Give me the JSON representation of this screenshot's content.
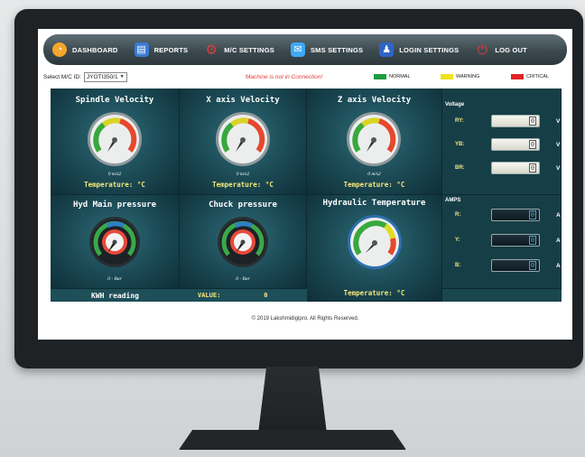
{
  "nav": {
    "items": [
      {
        "label": "DASHBOARD",
        "icon": "dashboard-gauge-icon",
        "color": "#f4a62a"
      },
      {
        "label": "REPORTS",
        "icon": "report-icon",
        "color": "#3a7bd5"
      },
      {
        "label": "M/C SETTINGS",
        "icon": "gear-icon",
        "color": "#e23b3b"
      },
      {
        "label": "SMS SETTINGS",
        "icon": "sms-icon",
        "color": "#3fa9f5"
      },
      {
        "label": "LOGIN SETTINGS",
        "icon": "user-settings-icon",
        "color": "#2f64c8"
      },
      {
        "label": "LOG OUT",
        "icon": "power-icon",
        "color": "#e23b3b"
      }
    ]
  },
  "status": {
    "select_label": "Select M/C ID:",
    "selected_machine": "JYOTI350/1",
    "connection_message": "Machine is not in Connection!",
    "legend": [
      {
        "label": "NORMAL",
        "color": "#1e9e3e"
      },
      {
        "label": "WARNING",
        "color": "#f2e21a"
      },
      {
        "label": "CRITICAL",
        "color": "#e02424"
      }
    ]
  },
  "gauges": {
    "spindle": {
      "title": "Spindle Velocity",
      "unit": "0 m/s2",
      "temp": "Temperature: °C"
    },
    "x_axis": {
      "title": "X axis Velocity",
      "unit": "0 m/s2",
      "temp": "Temperature: °C"
    },
    "z_axis": {
      "title": "Z axis Velocity",
      "unit": "0 m/s2",
      "temp": "Temperature: °C"
    },
    "hyd_main": {
      "title": "Hyd Main pressure",
      "unit": "0 - Bar"
    },
    "chuck": {
      "title": "Chuck pressure",
      "unit": "0 - Bar"
    },
    "hyd_temp": {
      "title": "Hydraulic Temperature",
      "temp": "Temperature: °C"
    }
  },
  "voltage": {
    "title": "Voltage",
    "rows": [
      {
        "label": "RY:",
        "value": "0",
        "unit": "V"
      },
      {
        "label": "YB:",
        "value": "0",
        "unit": "V"
      },
      {
        "label": "BR:",
        "value": "0",
        "unit": "V"
      }
    ]
  },
  "amps": {
    "title": "AMPS",
    "rows": [
      {
        "label": "R:",
        "value": "0",
        "unit": "A"
      },
      {
        "label": "Y:",
        "value": "0",
        "unit": "A"
      },
      {
        "label": "B:",
        "value": "0",
        "unit": "A"
      }
    ]
  },
  "kwh": {
    "label": "KWH reading",
    "value_label": "VALUE:",
    "value": "0"
  },
  "footer": {
    "copyright": "© 2019 Lakshmidigipro. All Rights Reserved."
  }
}
